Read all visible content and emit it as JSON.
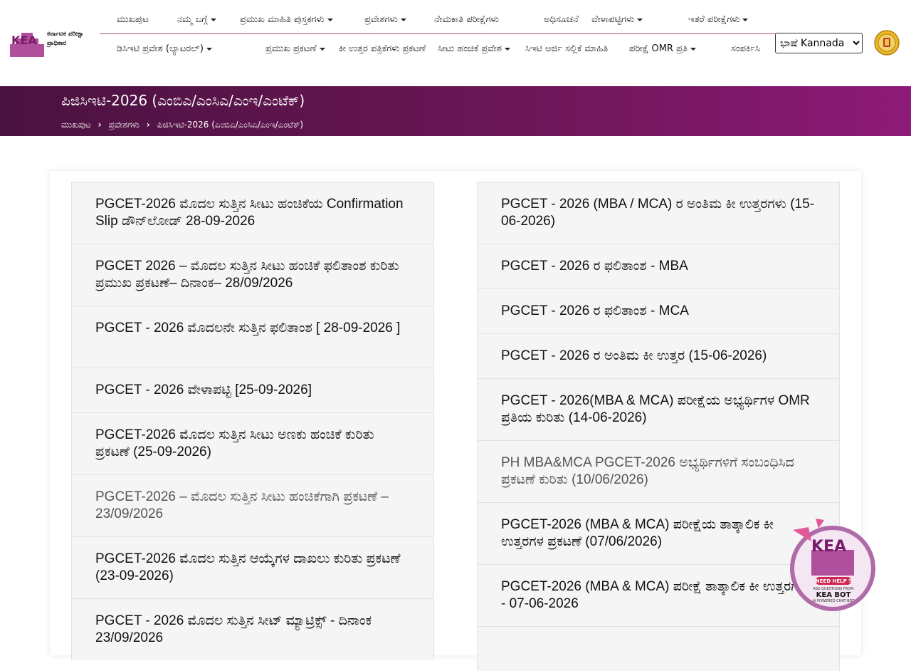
{
  "header": {
    "logo": {
      "mark": "KEA",
      "name": "ಕರ್ನಾಟಕ ಪರೀಕ್ಷಾ ಪ್ರಾಧಿಕಾರ"
    },
    "nav_row1": [
      {
        "label": "ಮುಖಪುಟ",
        "caret": false
      },
      {
        "label": "ನಮ್ಮ ಬಗ್ಗೆ",
        "caret": true
      },
      {
        "label": "ಪ್ರಮುಖ ಮಾಹಿತಿ ಪುಸ್ತಕಗಳು",
        "caret": true
      },
      {
        "label": "ಪ್ರವೇಶಗಳು",
        "caret": true
      },
      {
        "label": "ನೇಮಕಾತಿ ಪರೀಕ್ಷೆಗಳು",
        "caret": false
      },
      {
        "label": "ಅಧಿಸೂಚನೆ",
        "caret": false
      },
      {
        "label": "ವೇಳಾಪಟ್ಟಿಗಳು",
        "caret": true
      },
      {
        "label": "ಇತರೆ ಪರೀಕ್ಷೆಗಳು",
        "caret": true
      }
    ],
    "nav_row2": [
      {
        "label": "ಡಿಸಿಇಟಿ ಪ್ರವೇಶ (ಲ್ಯಾಟರಲ್)",
        "caret": true
      },
      {
        "label": "ಪ್ರಮುಖ ಪ್ರಕಟಣೆ",
        "caret": true
      },
      {
        "label": "ಕೀ ಉತ್ತರ ಪತ್ರಿಕೆಗಳು ಪ್ರಕಟಣೆ",
        "caret": false
      },
      {
        "label": "ಸೀಟು ಹಂಚಿಕೆ ಪ್ರವೇಶ",
        "caret": true
      },
      {
        "label": "ಸಿಇಟಿ ಅರ್ಜಿ ಸಲ್ಲಿಕೆ ಮಾಹಿತಿ",
        "caret": false
      },
      {
        "label": "ಪರೀಕ್ಷೆ OMR ಪ್ರತಿ",
        "caret": true
      },
      {
        "label": "ಸಂಪರ್ಕಿಸಿ",
        "caret": false
      }
    ],
    "language_select": "ಭಾಷೆ Kannada",
    "emblem": "karnataka-emblem"
  },
  "banner": {
    "title": "ಪಿಜಿಸಿಇಟಿ-2026 (ಎಂಬಿಎ/ಎಂಸಿಎ/ಎಂಇ/ಎಂಟೆಕ್)",
    "breadcrumb": [
      "ಮುಖಪುಟ",
      "ಪ್ರವೇಶಗಳು",
      "ಪಿಜಿಸಿಇಟಿ-2026 (ಎಂಬಿಎ/ಎಂಸಿಎ/ಎಂಇ/ಎಂಟೆಕ್)"
    ]
  },
  "left_column": [
    {
      "text": "PGCET-2026 ಮೊದಲ ಸುತ್ತಿನ ಸೀಟು ಹಂಚಿಕೆಯ Confirmation Slip ಡೌನ್‌ಲೋಡ್ 28-09-2026",
      "muted": false,
      "rows": 2
    },
    {
      "text": "PGCET 2026 – ಮೊದಲ ಸುತ್ತಿನ ಸೀಟು ಹಂಚಿಕೆ ಫಲಿತಾಂಶ ಕುರಿತು ಪ್ರಮುಖ ಪ್ರಕಟಣೆ– ದಿನಾಂಕ– 28/09/2026",
      "muted": false,
      "rows": 2
    },
    {
      "text": "PGCET - 2026 ಮೊದಲನೇ ಸುತ್ತಿನ ಫಲಿತಾಂಶ [ 28-09-2026 ]",
      "muted": false,
      "rows": 2
    },
    {
      "text": "PGCET - 2026 ವೇಳಾಪಟ್ಟಿ [25-09-2026]",
      "muted": false,
      "rows": 1
    },
    {
      "text": "PGCET-2026 ಮೊದಲ ಸುತ್ತಿನ ಸೀಟು ಅಣಕು ಹಂಚಿಕೆ ಕುರಿತು ಪ್ರಕಟಣೆ (25-09-2026)",
      "muted": false,
      "rows": 2
    },
    {
      "text": "PGCET-2026 – ಮೊದಲ ಸುತ್ತಿನ ಸೀಟು ಹಂಚಿಕೆಗಾಗಿ ಪ್ರಕಟಣೆ – 23/09/2026",
      "muted": true,
      "rows": 2
    },
    {
      "text": "PGCET-2026 ಮೊದಲ ಸುತ್ತಿನ ಆಯ್ಕೆಗಳ ದಾಖಲು ಕುರಿತು ಪ್ರಕಟಣೆ (23-09-2026)",
      "muted": false,
      "rows": 2
    },
    {
      "text": "PGCET - 2026 ಮೊದಲ ಸುತ್ತಿನ ಸೀಟ್ ಮ್ಯಾಟ್ರಿಕ್ಸ್ - ದಿನಾಂಕ 23/09/2026",
      "muted": false,
      "rows": 2
    }
  ],
  "right_column": [
    {
      "text": "PGCET - 2026 (MBA / MCA) ರ ಅಂತಿಮ ಕೀ ಉತ್ತರಗಳು (15-06-2026)",
      "muted": false,
      "rows": 2
    },
    {
      "text": "PGCET - 2026 ರ ಫಲಿತಾಂಶ - MBA",
      "muted": false,
      "rows": 1
    },
    {
      "text": "PGCET - 2026 ರ ಫಲಿತಾಂಶ - MCA",
      "muted": false,
      "rows": 1
    },
    {
      "text": "PGCET - 2026 ರ ಅಂತಿಮ ಕೀ ಉತ್ತರ (15-06-2026)",
      "muted": false,
      "rows": 1
    },
    {
      "text": "PGCET - 2026(MBA & MCA) ಪರೀಕ್ಷೆಯ ಅಭ್ಯರ್ಥಿಗಳ OMR ಪ್ರತಿಯ ಕುರಿತು (14-06-2026)",
      "muted": false,
      "rows": 2
    },
    {
      "text": "PH MBA&MCA PGCET-2026 ಅಭ್ಯರ್ಥಿಗಳಿಗೆ ಸಂಬಂಧಿಸಿದ ಪ್ರಕಟಣೆ ಕುರಿತು (10/06/2026)",
      "muted": true,
      "rows": 2
    },
    {
      "text": "PGCET-2026 (MBA & MCA) ಪರೀಕ್ಷೆಯ ತಾತ್ಕಾಲಿಕ ಕೀ ಉತ್ತರಗಳ ಪ್ರಕಟಣೆ (07/06/2026)",
      "muted": false,
      "rows": 2
    },
    {
      "text": "PGCET-2026 (MBA & MCA) ಪರೀಕ್ಷೆ ತಾತ್ಕಾಲಿಕ ಕೀ ಉತ್ತರಗಳು - 07-06-2026",
      "muted": false,
      "rows": 2
    },
    {
      "text": "",
      "muted": false,
      "rows": 1
    }
  ],
  "chatbot": {
    "mark": "KEA",
    "badge": "NEED HELP ?",
    "line1": "ASK QUESTIONS FROM",
    "line2": "KEA BOT",
    "line3": "AI POWERED CHAT BOT"
  }
}
